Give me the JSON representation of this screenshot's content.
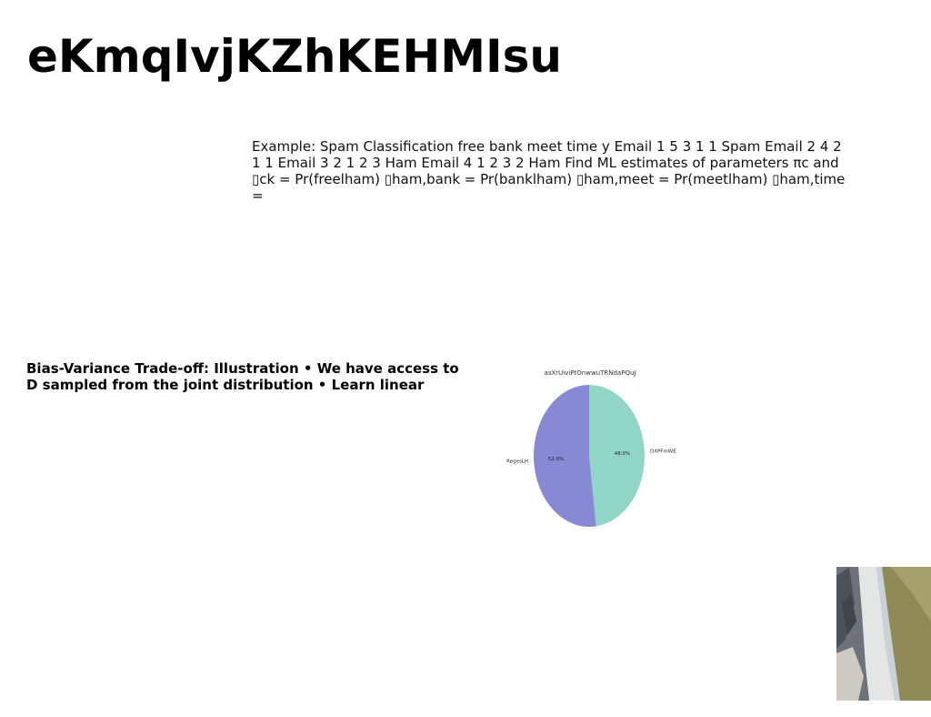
{
  "title": "eKmqIvjKZhKEHMIsu",
  "body_text": "Example: Spam Classification free bank meet time y Email 1 5 3 1 1 Spam Email 2 4 2 1 1 Email 3 2 1 2 3 Ham Email 4 1 2 3 2 Ham Find ML estimates of parameters πc and ▯ck = Pr(freelham) ▯ham,bank = Pr(banklham) ▯ham,meet = Pr(meetlham) ▯ham,time =",
  "side_note": "Bias-Variance Trade-off: Illustration • We have access to D sampled from the joint distribution • Learn linear",
  "chart_data": {
    "type": "pie",
    "title": "asXrUiviPtOnwwuTRNdaPQuJ",
    "slices": [
      {
        "label": "DXPFmWE",
        "value": 48.0,
        "display": "48.0%",
        "color": "#91d5c7"
      },
      {
        "label": "RegesLH",
        "value": 52.0,
        "display": "52.0%",
        "color": "#8789d5"
      }
    ],
    "start_angle_deg": 90,
    "direction": "clockwise",
    "legend": "none"
  }
}
